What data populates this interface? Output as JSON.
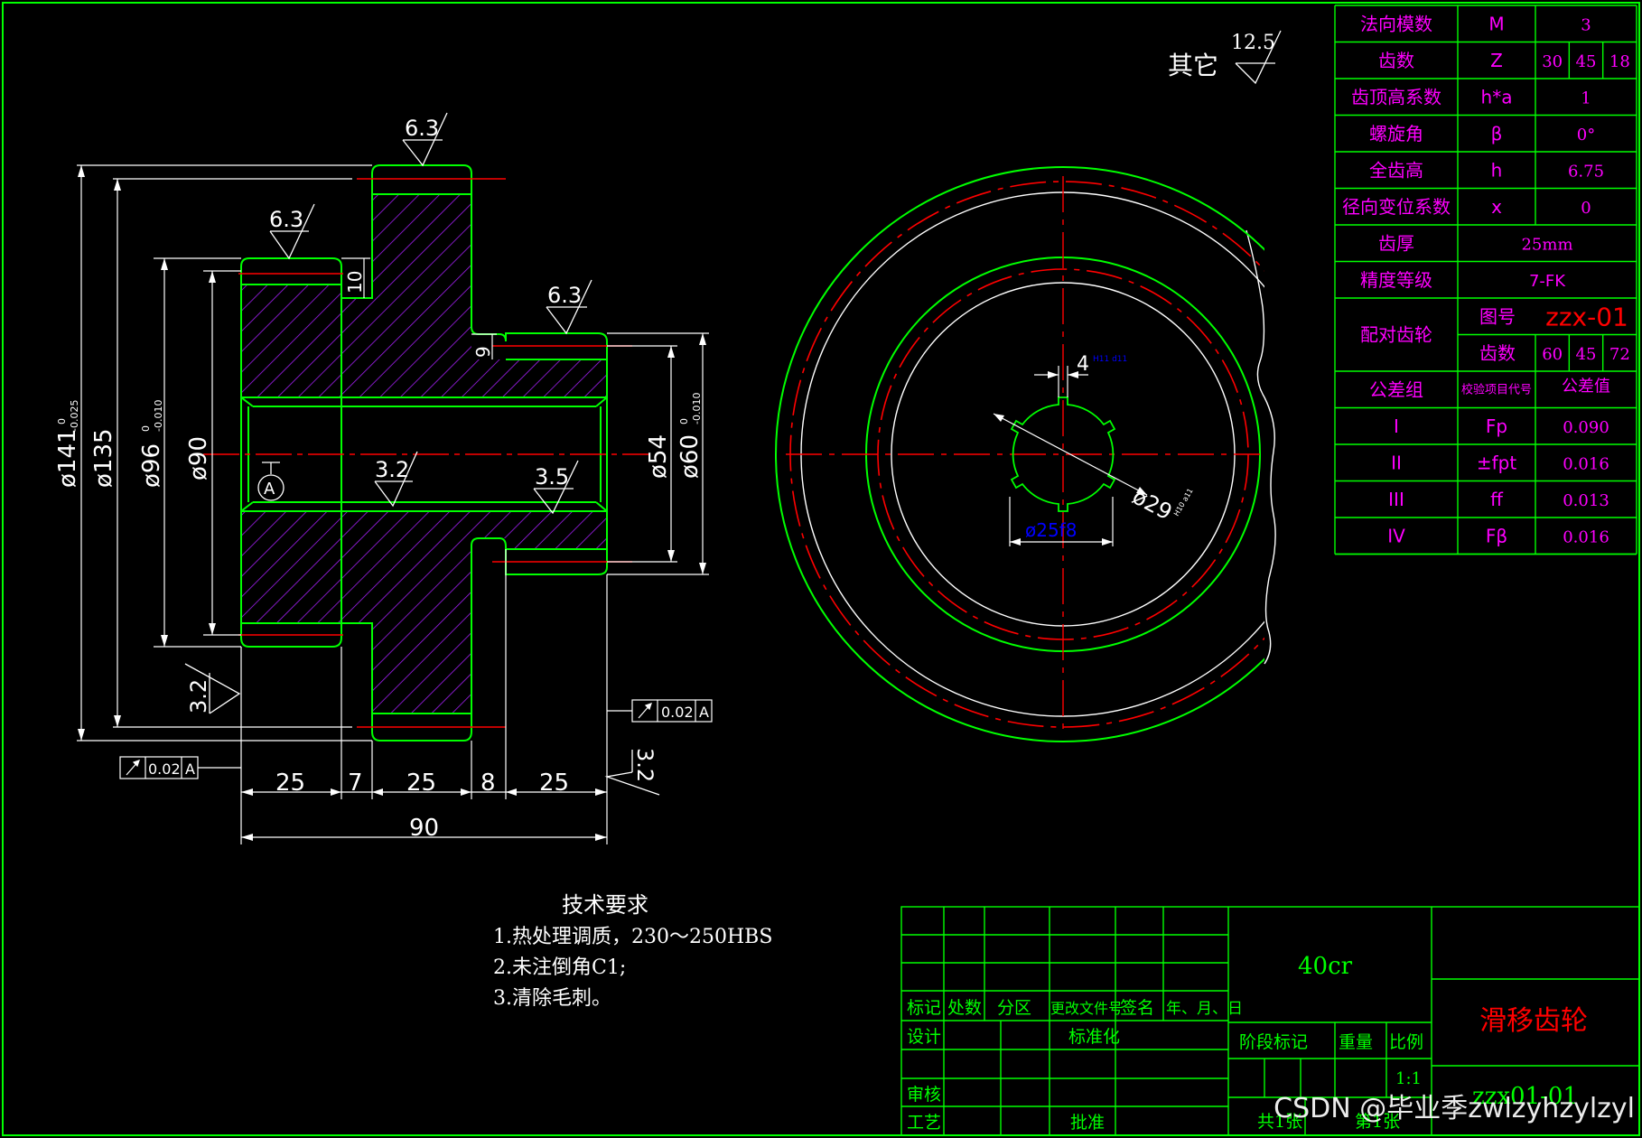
{
  "drawing": {
    "other_label": "其它",
    "other_roughness": "12.5",
    "roughness_values": [
      "6.3",
      "6.3",
      "6.3",
      "3.2",
      "3.5",
      "3.2",
      "3.2"
    ],
    "dim_d141": "ø141",
    "dim_d141_tol_upper": "0",
    "dim_d141_tol_lower": "-0.025",
    "dim_d135": "ø135",
    "dim_d96": "ø96",
    "dim_d96_tol_upper": "0",
    "dim_d96_tol_lower": "-0.010",
    "dim_d90": "ø90",
    "dim_d54": "ø54",
    "dim_d60": "ø60",
    "dim_d60_tol_upper": "0",
    "dim_d60_tol_lower": "-0.010",
    "dim_10": "10",
    "dim_9": "9",
    "dim_lengths": [
      "25",
      "7",
      "25",
      "8",
      "25"
    ],
    "dim_total": "90",
    "datum": "A",
    "runout_value": "0.02",
    "runout_datum": "A",
    "spline_width": "4",
    "spline_width_tol": "H11 d11",
    "spline_minor": "ø25f8",
    "spline_major": "ø29",
    "spline_major_tol": "H10 a11"
  },
  "tech_req": {
    "title": "技术要求",
    "items": [
      "1.热处理调质，230～250HBS",
      "2.未注倒角C1;",
      "3.清除毛刺。"
    ]
  },
  "gear_table": {
    "rows": [
      {
        "label": "法向模数",
        "sym": "M",
        "val": "3"
      },
      {
        "label": "齿数",
        "sym": "Z",
        "vals": [
          "30",
          "45",
          "18"
        ]
      },
      {
        "label": "齿顶高系数",
        "sym": "h*a",
        "val": "1"
      },
      {
        "label": "螺旋角",
        "sym": "β",
        "val": "0°"
      },
      {
        "label": "全齿高",
        "sym": "h",
        "val": "6.75"
      },
      {
        "label": "径向变位系数",
        "sym": "x",
        "val": "0"
      },
      {
        "label": "齿厚",
        "val": "25mm"
      },
      {
        "label": "精度等级",
        "val": "7-FK"
      }
    ],
    "mating_label": "配对齿轮",
    "drawing_no_label": "图号",
    "drawing_no": "zzx-01",
    "teeth_label": "齿数",
    "teeth_vals": [
      "60",
      "45",
      "72"
    ],
    "tol_group_label": "公差组",
    "check_item_label": "校验项目代号",
    "tol_value_label": "公差值",
    "tol_rows": [
      {
        "group": "I",
        "sym": "Fp",
        "val": "0.090"
      },
      {
        "group": "II",
        "sym": "±fpt",
        "val": "0.016"
      },
      {
        "group": "III",
        "sym": "ff",
        "val": "0.013"
      },
      {
        "group": "IV",
        "sym": "Fβ",
        "val": "0.016"
      }
    ]
  },
  "title_block": {
    "material": "40cr",
    "part_name": "滑移齿轮",
    "headers": [
      "标记",
      "处数",
      "分区",
      "更改文件号",
      "签名",
      "年、月、日"
    ],
    "design": "设计",
    "standardize": "标准化",
    "review": "审核",
    "process": "工艺",
    "approve": "批准",
    "stage_mark": "阶段标记",
    "weight": "重量",
    "scale_label": "比例",
    "scale": "1:1",
    "total_sheets": "共1张",
    "sheet_no": "第1张",
    "drawing_code": "zzx01-01"
  },
  "watermark": "CSDN @毕业季zwlzyhzylzyl",
  "colors": {
    "background": "#000000",
    "outline": "#00ff00",
    "centerline": "#ff0000",
    "dimension": "#ffffff",
    "hatch": "#a020f0",
    "table_text": "#ff00ff",
    "title_text": "#00ff00",
    "part_name": "#ff0000",
    "spline_dim": "#0000ff"
  }
}
